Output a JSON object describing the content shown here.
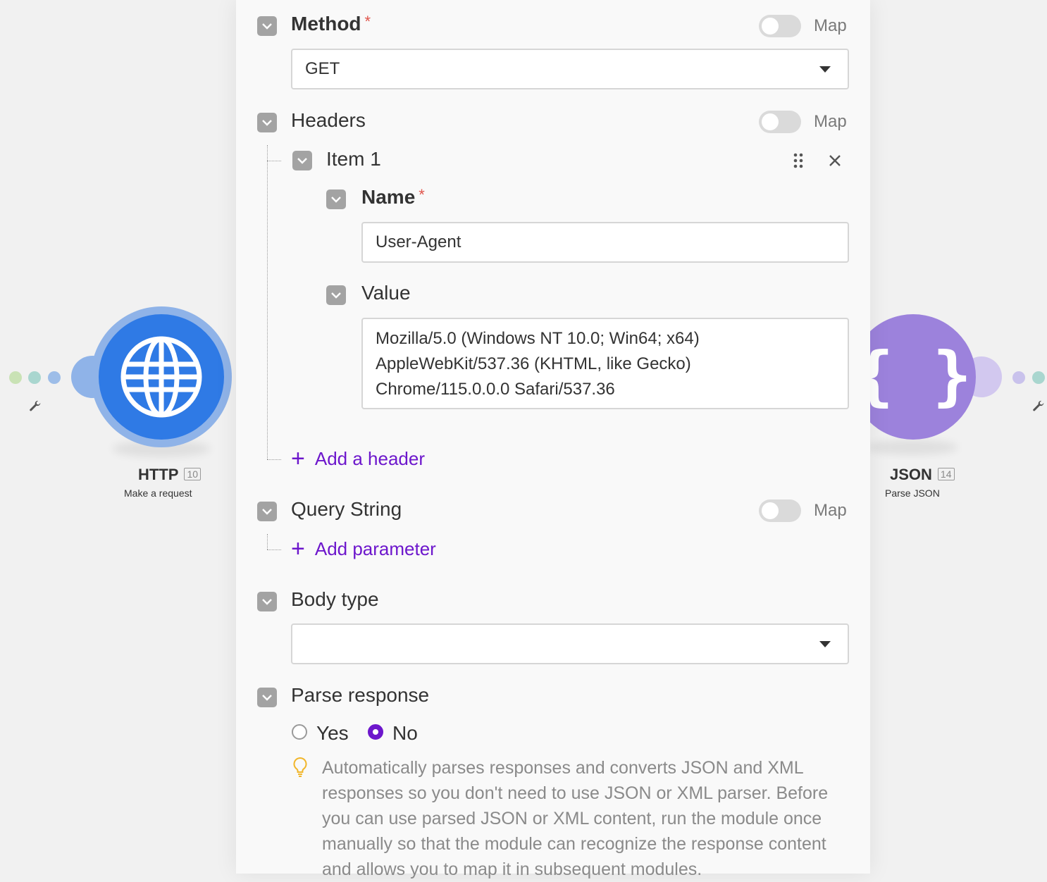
{
  "colors": {
    "accent": "#6d17cc",
    "http": "#2f7ae5",
    "json": "#9c82dc",
    "required": "#e0554c"
  },
  "modules": {
    "http": {
      "title": "HTTP",
      "badge": "10",
      "subtitle": "Make a request",
      "icon": "globe-icon"
    },
    "json": {
      "title": "JSON",
      "badge": "14",
      "subtitle": "Parse JSON",
      "icon": "braces-icon"
    }
  },
  "form": {
    "method": {
      "label": "Method",
      "required_mark": "*",
      "map_label": "Map",
      "value": "GET"
    },
    "headers": {
      "label": "Headers",
      "map_label": "Map",
      "item": {
        "label": "Item 1",
        "name": {
          "label": "Name",
          "required_mark": "*",
          "value": "User-Agent"
        },
        "value": {
          "label": "Value",
          "lines": [
            "Mozilla/5.0 (Windows NT 10.0; Win64; x64)",
            "AppleWebKit/537.36 (KHTML, like Gecko)",
            "Chrome/115.0.0.0 Safari/537.36"
          ]
        }
      },
      "add_label": "Add a header"
    },
    "query_string": {
      "label": "Query String",
      "map_label": "Map",
      "add_label": "Add parameter"
    },
    "body_type": {
      "label": "Body type",
      "value": ""
    },
    "parse_response": {
      "label": "Parse response",
      "options": [
        {
          "label": "Yes",
          "selected": false
        },
        {
          "label": "No",
          "selected": true
        }
      ],
      "hint_lines": [
        "Automatically parses responses and converts JSON and XML",
        "responses so you don't need to use JSON or XML parser. Before",
        "you can use parsed JSON or XML content, run the module once",
        "manually so that the module can recognize the response content",
        "and allows you to map it in subsequent modules."
      ]
    }
  }
}
